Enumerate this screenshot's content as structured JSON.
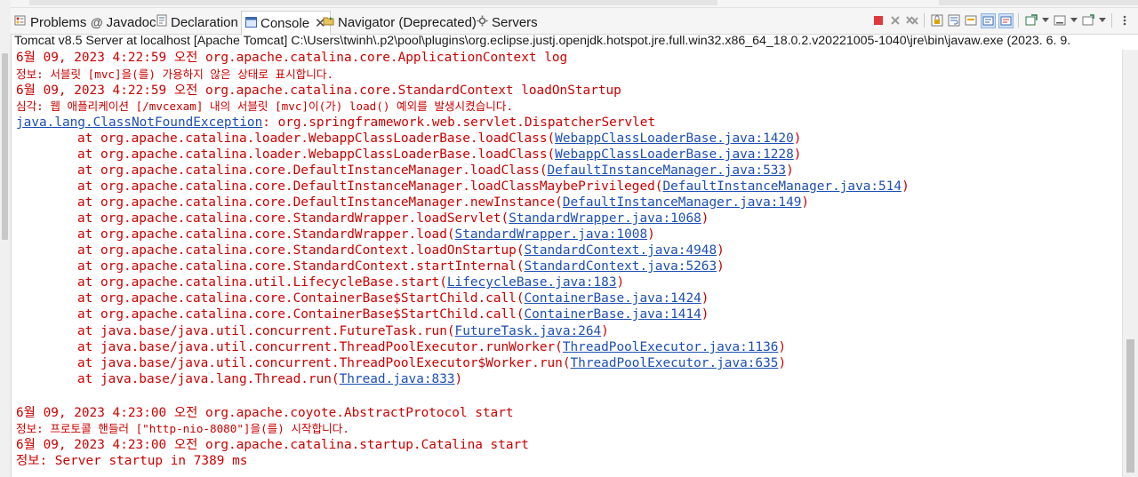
{
  "tabs": [
    {
      "label": "Problems",
      "icon": "problems-icon",
      "active": false
    },
    {
      "label": "Javadoc",
      "icon": "javadoc-icon",
      "active": false
    },
    {
      "label": "Declaration",
      "icon": "declaration-icon",
      "active": false
    },
    {
      "label": "Console",
      "icon": "console-icon",
      "active": true,
      "close": "✕"
    },
    {
      "label": "Navigator (Deprecated)",
      "icon": "navigator-icon",
      "active": false
    },
    {
      "label": "Servers",
      "icon": "servers-icon",
      "active": false
    }
  ],
  "toolbar": {
    "icons": [
      "terminate-icon",
      "remove-launch-icon",
      "remove-all-terminated-icon",
      "scroll-lock-icon",
      "word-wrap-icon",
      "show-on-stdout-icon",
      "show-on-stderr-icon",
      "pin-console-icon",
      "display-selected-console-icon",
      "open-console-icon",
      "view-menu-icon"
    ]
  },
  "process_title": "Tomcat v8.5 Server at localhost [Apache Tomcat] C:\\Users\\twinh\\.p2\\pool\\plugins\\org.eclipse.justj.openjdk.hotspot.jre.full.win32.x86_64_18.0.2.v20221005-1040\\jre\\bin\\javaw.exe  (2023. 6. 9.",
  "console": {
    "l1": "6월 09, 2023 4:22:59 오전 org.apache.catalina.core.ApplicationContext log",
    "l2": "정보: 서블릿 [mvc]을(를) 가용하지 않은 상태로 표시합니다.",
    "l3": "6월 09, 2023 4:22:59 오전 org.apache.catalina.core.StandardContext loadOnStartup",
    "l4": "심각: 웹 애플리케이션 [/mvcexam] 내의 서블릿 [mvc]이(가) load() 예외를 발생시켰습니다.",
    "l5_link": "java.lang.ClassNotFoundException",
    "l5_text": ": org.springframework.web.servlet.DispatcherServlet",
    "stack": [
      {
        "text": "at org.apache.catalina.loader.WebappClassLoaderBase.loadClass(",
        "link": "WebappClassLoaderBase.java:1420",
        "end": ")"
      },
      {
        "text": "at org.apache.catalina.loader.WebappClassLoaderBase.loadClass(",
        "link": "WebappClassLoaderBase.java:1228",
        "end": ")"
      },
      {
        "text": "at org.apache.catalina.core.DefaultInstanceManager.loadClass(",
        "link": "DefaultInstanceManager.java:533",
        "end": ")"
      },
      {
        "text": "at org.apache.catalina.core.DefaultInstanceManager.loadClassMaybePrivileged(",
        "link": "DefaultInstanceManager.java:514",
        "end": ")"
      },
      {
        "text": "at org.apache.catalina.core.DefaultInstanceManager.newInstance(",
        "link": "DefaultInstanceManager.java:149",
        "end": ")"
      },
      {
        "text": "at org.apache.catalina.core.StandardWrapper.loadServlet(",
        "link": "StandardWrapper.java:1068",
        "end": ")"
      },
      {
        "text": "at org.apache.catalina.core.StandardWrapper.load(",
        "link": "StandardWrapper.java:1008",
        "end": ")"
      },
      {
        "text": "at org.apache.catalina.core.StandardContext.loadOnStartup(",
        "link": "StandardContext.java:4948",
        "end": ")"
      },
      {
        "text": "at org.apache.catalina.core.StandardContext.startInternal(",
        "link": "StandardContext.java:5263",
        "end": ")"
      },
      {
        "text": "at org.apache.catalina.util.LifecycleBase.start(",
        "link": "LifecycleBase.java:183",
        "end": ")"
      },
      {
        "text": "at org.apache.catalina.core.ContainerBase$StartChild.call(",
        "link": "ContainerBase.java:1424",
        "end": ")"
      },
      {
        "text": "at org.apache.catalina.core.ContainerBase$StartChild.call(",
        "link": "ContainerBase.java:1414",
        "end": ")"
      },
      {
        "text": "at java.base/java.util.concurrent.FutureTask.run(",
        "link": "FutureTask.java:264",
        "end": ")"
      },
      {
        "text": "at java.base/java.util.concurrent.ThreadPoolExecutor.runWorker(",
        "link": "ThreadPoolExecutor.java:1136",
        "end": ")"
      },
      {
        "text": "at java.base/java.util.concurrent.ThreadPoolExecutor$Worker.run(",
        "link": "ThreadPoolExecutor.java:635",
        "end": ")"
      },
      {
        "text": "at java.base/java.lang.Thread.run(",
        "link": "Thread.java:833",
        "end": ")"
      }
    ],
    "l22": "6월 09, 2023 4:23:00 오전 org.apache.coyote.AbstractProtocol start",
    "l23": "정보: 프로토콜 핸들러 [\"http-nio-8080\"]을(를) 시작합니다.",
    "l24": "6월 09, 2023 4:23:00 오전 org.apache.catalina.startup.Catalina start",
    "l25": "정보: Server startup in 7389 ms"
  },
  "colors": {
    "stderr": "#cc0000",
    "link": "#1d4fb4"
  }
}
